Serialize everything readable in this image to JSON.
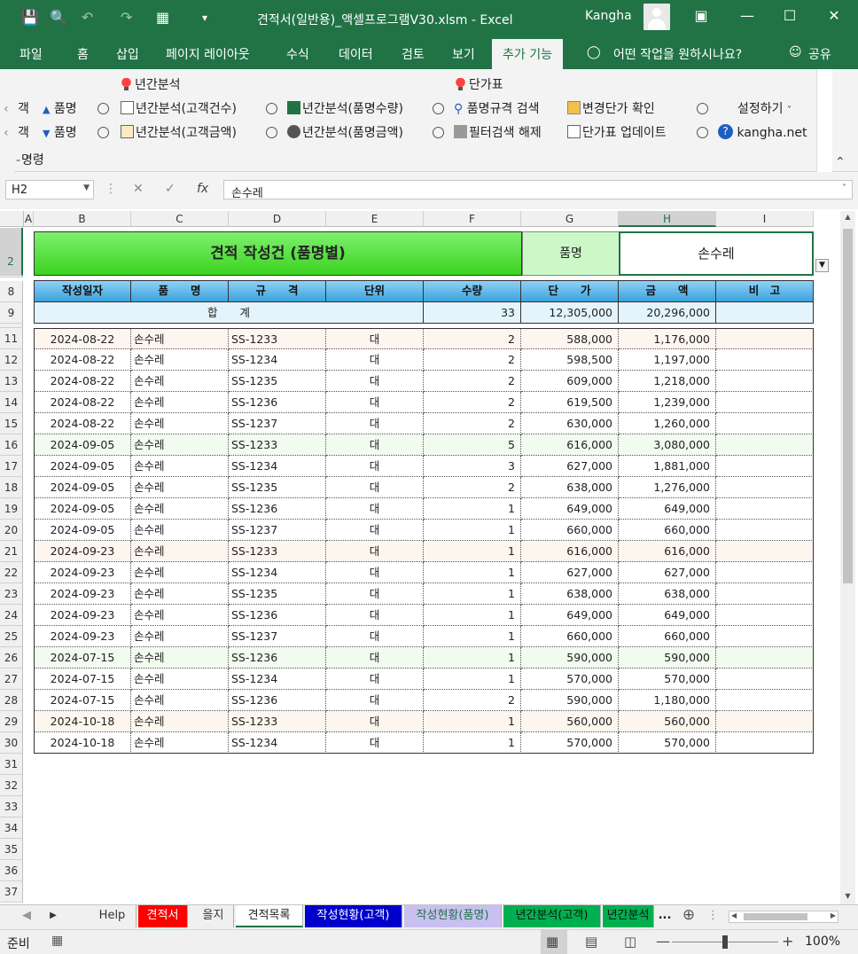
{
  "window": {
    "title": "견적서(일반용)_액셀프로그램V30.xlsm  -  Excel",
    "user": "Kangha"
  },
  "menu": [
    "파일",
    "홈",
    "삽입",
    "페이지 레이아웃",
    "수식",
    "데이터",
    "검토",
    "보기",
    "추가 기능"
  ],
  "menu_tell": "어떤 작업을 원하시나요?",
  "menu_share": "공유",
  "ribbon": {
    "group1_title": "년간분석",
    "group2_title": "단가표",
    "left_partial_1": "객",
    "left_partial_2": "객",
    "sort_asc": "품명",
    "sort_desc": "품명",
    "btn_customer_count": "년간분석(고객건수)",
    "btn_customer_amount": "년간분석(고객금액)",
    "btn_item_qty": "년간분석(품명수량)",
    "btn_item_amount": "년간분석(품명금액)",
    "btn_spec_search": "품명규격 검색",
    "btn_filter_clear": "필터검색 해제",
    "btn_price_check": "변경단가 확인",
    "btn_price_update": "단가표 업데이트",
    "btn_settings": "설정하기",
    "btn_site": "kangha.net",
    "group_label": "명령"
  },
  "formula": {
    "namebox": "H2",
    "content": "손수레"
  },
  "columns": [
    "A",
    "B",
    "C",
    "D",
    "E",
    "F",
    "G",
    "H",
    "I"
  ],
  "sheet": {
    "banner": "견적 작성건 (품명별)",
    "filter_label": "품명",
    "filter_value": "손수레",
    "headers": [
      "작성일자",
      "품　　명",
      "규　　격",
      "단위",
      "수량",
      "단　　가",
      "금　　액",
      "비　고"
    ],
    "total_label": "합　　계",
    "total_qty": "33",
    "total_price": "12,305,000",
    "total_amount": "20,296,000",
    "rows": [
      {
        "n": "11",
        "date": "2024-08-22",
        "item": "손수레",
        "spec": "SS-1233",
        "unit": "대",
        "qty": "2",
        "price": "588,000",
        "amount": "1,176,000",
        "bg": "#fdf6ef"
      },
      {
        "n": "12",
        "date": "2024-08-22",
        "item": "손수레",
        "spec": "SS-1234",
        "unit": "대",
        "qty": "2",
        "price": "598,500",
        "amount": "1,197,000",
        "bg": "#ffffff"
      },
      {
        "n": "13",
        "date": "2024-08-22",
        "item": "손수레",
        "spec": "SS-1235",
        "unit": "대",
        "qty": "2",
        "price": "609,000",
        "amount": "1,218,000",
        "bg": "#ffffff"
      },
      {
        "n": "14",
        "date": "2024-08-22",
        "item": "손수레",
        "spec": "SS-1236",
        "unit": "대",
        "qty": "2",
        "price": "619,500",
        "amount": "1,239,000",
        "bg": "#ffffff"
      },
      {
        "n": "15",
        "date": "2024-08-22",
        "item": "손수레",
        "spec": "SS-1237",
        "unit": "대",
        "qty": "2",
        "price": "630,000",
        "amount": "1,260,000",
        "bg": "#ffffff"
      },
      {
        "n": "16",
        "date": "2024-09-05",
        "item": "손수레",
        "spec": "SS-1233",
        "unit": "대",
        "qty": "5",
        "price": "616,000",
        "amount": "3,080,000",
        "bg": "#f1fbef"
      },
      {
        "n": "17",
        "date": "2024-09-05",
        "item": "손수레",
        "spec": "SS-1234",
        "unit": "대",
        "qty": "3",
        "price": "627,000",
        "amount": "1,881,000",
        "bg": "#ffffff"
      },
      {
        "n": "18",
        "date": "2024-09-05",
        "item": "손수레",
        "spec": "SS-1235",
        "unit": "대",
        "qty": "2",
        "price": "638,000",
        "amount": "1,276,000",
        "bg": "#ffffff"
      },
      {
        "n": "19",
        "date": "2024-09-05",
        "item": "손수레",
        "spec": "SS-1236",
        "unit": "대",
        "qty": "1",
        "price": "649,000",
        "amount": "649,000",
        "bg": "#ffffff"
      },
      {
        "n": "20",
        "date": "2024-09-05",
        "item": "손수레",
        "spec": "SS-1237",
        "unit": "대",
        "qty": "1",
        "price": "660,000",
        "amount": "660,000",
        "bg": "#ffffff"
      },
      {
        "n": "21",
        "date": "2024-09-23",
        "item": "손수레",
        "spec": "SS-1233",
        "unit": "대",
        "qty": "1",
        "price": "616,000",
        "amount": "616,000",
        "bg": "#fdf6ef"
      },
      {
        "n": "22",
        "date": "2024-09-23",
        "item": "손수레",
        "spec": "SS-1234",
        "unit": "대",
        "qty": "1",
        "price": "627,000",
        "amount": "627,000",
        "bg": "#ffffff"
      },
      {
        "n": "23",
        "date": "2024-09-23",
        "item": "손수레",
        "spec": "SS-1235",
        "unit": "대",
        "qty": "1",
        "price": "638,000",
        "amount": "638,000",
        "bg": "#ffffff"
      },
      {
        "n": "24",
        "date": "2024-09-23",
        "item": "손수레",
        "spec": "SS-1236",
        "unit": "대",
        "qty": "1",
        "price": "649,000",
        "amount": "649,000",
        "bg": "#ffffff"
      },
      {
        "n": "25",
        "date": "2024-09-23",
        "item": "손수레",
        "spec": "SS-1237",
        "unit": "대",
        "qty": "1",
        "price": "660,000",
        "amount": "660,000",
        "bg": "#ffffff"
      },
      {
        "n": "26",
        "date": "2024-07-15",
        "item": "손수레",
        "spec": "SS-1236",
        "unit": "대",
        "qty": "1",
        "price": "590,000",
        "amount": "590,000",
        "bg": "#f1fbef"
      },
      {
        "n": "27",
        "date": "2024-07-15",
        "item": "손수레",
        "spec": "SS-1234",
        "unit": "대",
        "qty": "1",
        "price": "570,000",
        "amount": "570,000",
        "bg": "#ffffff"
      },
      {
        "n": "28",
        "date": "2024-07-15",
        "item": "손수레",
        "spec": "SS-1236",
        "unit": "대",
        "qty": "2",
        "price": "590,000",
        "amount": "1,180,000",
        "bg": "#ffffff"
      },
      {
        "n": "29",
        "date": "2024-10-18",
        "item": "손수레",
        "spec": "SS-1233",
        "unit": "대",
        "qty": "1",
        "price": "560,000",
        "amount": "560,000",
        "bg": "#fdf6ef"
      },
      {
        "n": "30",
        "date": "2024-10-18",
        "item": "손수레",
        "spec": "SS-1234",
        "unit": "대",
        "qty": "1",
        "price": "570,000",
        "amount": "570,000",
        "bg": "#ffffff"
      }
    ],
    "empty_rows": [
      "31",
      "32",
      "33",
      "34",
      "35",
      "36",
      "37"
    ]
  },
  "tabs": [
    {
      "label": "Help",
      "bg": "#f0f0f0",
      "fg": "#333"
    },
    {
      "label": "견적서",
      "bg": "#ff0000",
      "fg": "#ffffff"
    },
    {
      "label": "을지",
      "bg": "#f0f0f0",
      "fg": "#333"
    },
    {
      "label": "견적목록",
      "bg": "#ffffff",
      "fg": "#222"
    },
    {
      "label": "작성현황(고객)",
      "bg": "#0000cc",
      "fg": "#ffffff"
    },
    {
      "label": "작성현황(품명)",
      "bg": "#c8c0f0",
      "fg": "#217346"
    },
    {
      "label": "년간분석(고객)",
      "bg": "#00b050",
      "fg": "#111"
    },
    {
      "label": "년간분석",
      "bg": "#00b050",
      "fg": "#111"
    }
  ],
  "tab_more": "...",
  "status": {
    "ready": "준비",
    "zoom": "100%"
  },
  "colors": {
    "excel_green": "#217346",
    "header_blue": "#3ba2dd",
    "banner_green": "#3bd31f"
  }
}
